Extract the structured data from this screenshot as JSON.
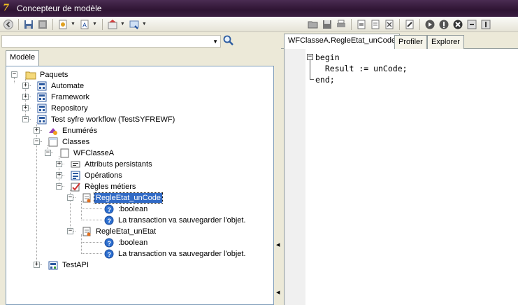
{
  "window": {
    "title": "Concepteur de modèle"
  },
  "toolbar_left": {
    "icons": [
      "back-icon",
      "save-all-icon",
      "close-doc-icon",
      "new-item-icon",
      "new-attr-icon",
      "properties-icon",
      "navigate-icon"
    ]
  },
  "search": {
    "value": "",
    "button": "search-icon"
  },
  "left_tabs": [
    {
      "label": "Modèle",
      "active": true
    }
  ],
  "tree": {
    "nodes": [
      {
        "label": "Paquets",
        "icon": "folder-icon"
      },
      {
        "label": "Automate",
        "icon": "package-icon"
      },
      {
        "label": "Framework",
        "icon": "package-icon"
      },
      {
        "label": "Repository",
        "icon": "package-icon"
      },
      {
        "label": "Test syfre workflow (TestSYFREWF)",
        "icon": "package-icon"
      },
      {
        "label": "Enumérés",
        "icon": "enum-icon"
      },
      {
        "label": "Classes",
        "icon": "classes-icon"
      },
      {
        "label": "WFClasseA",
        "icon": "class-icon"
      },
      {
        "label": "Attributs persistants",
        "icon": "attributes-icon"
      },
      {
        "label": "Opérations",
        "icon": "operations-icon"
      },
      {
        "label": "Règles métiers",
        "icon": "rules-icon"
      },
      {
        "label": "RegleEtat_unCode",
        "icon": "rule-icon",
        "selected": true
      },
      {
        "label": ":boolean",
        "icon": "info-icon"
      },
      {
        "label": "La transaction va sauvegarder l'objet.",
        "icon": "info-icon"
      },
      {
        "label": "RegleEtat_unEtat",
        "icon": "rule-icon"
      },
      {
        "label": ":boolean",
        "icon": "info-icon"
      },
      {
        "label": "La transaction va sauvegarder l'objet.",
        "icon": "info-icon"
      },
      {
        "label": "TestAPI",
        "icon": "package-icon"
      }
    ]
  },
  "right_tabs": [
    {
      "label": "WFClasseA.RegleEtat_unCode",
      "active": true
    },
    {
      "label": "Profiler",
      "active": false
    },
    {
      "label": "Explorer",
      "active": false
    }
  ],
  "editor": {
    "lines": [
      "begin",
      "  Result := unCode;",
      "end;"
    ]
  },
  "colors": {
    "titlebar": "#2e1433",
    "selection": "#316ac5",
    "chrome": "#ece9d8"
  }
}
